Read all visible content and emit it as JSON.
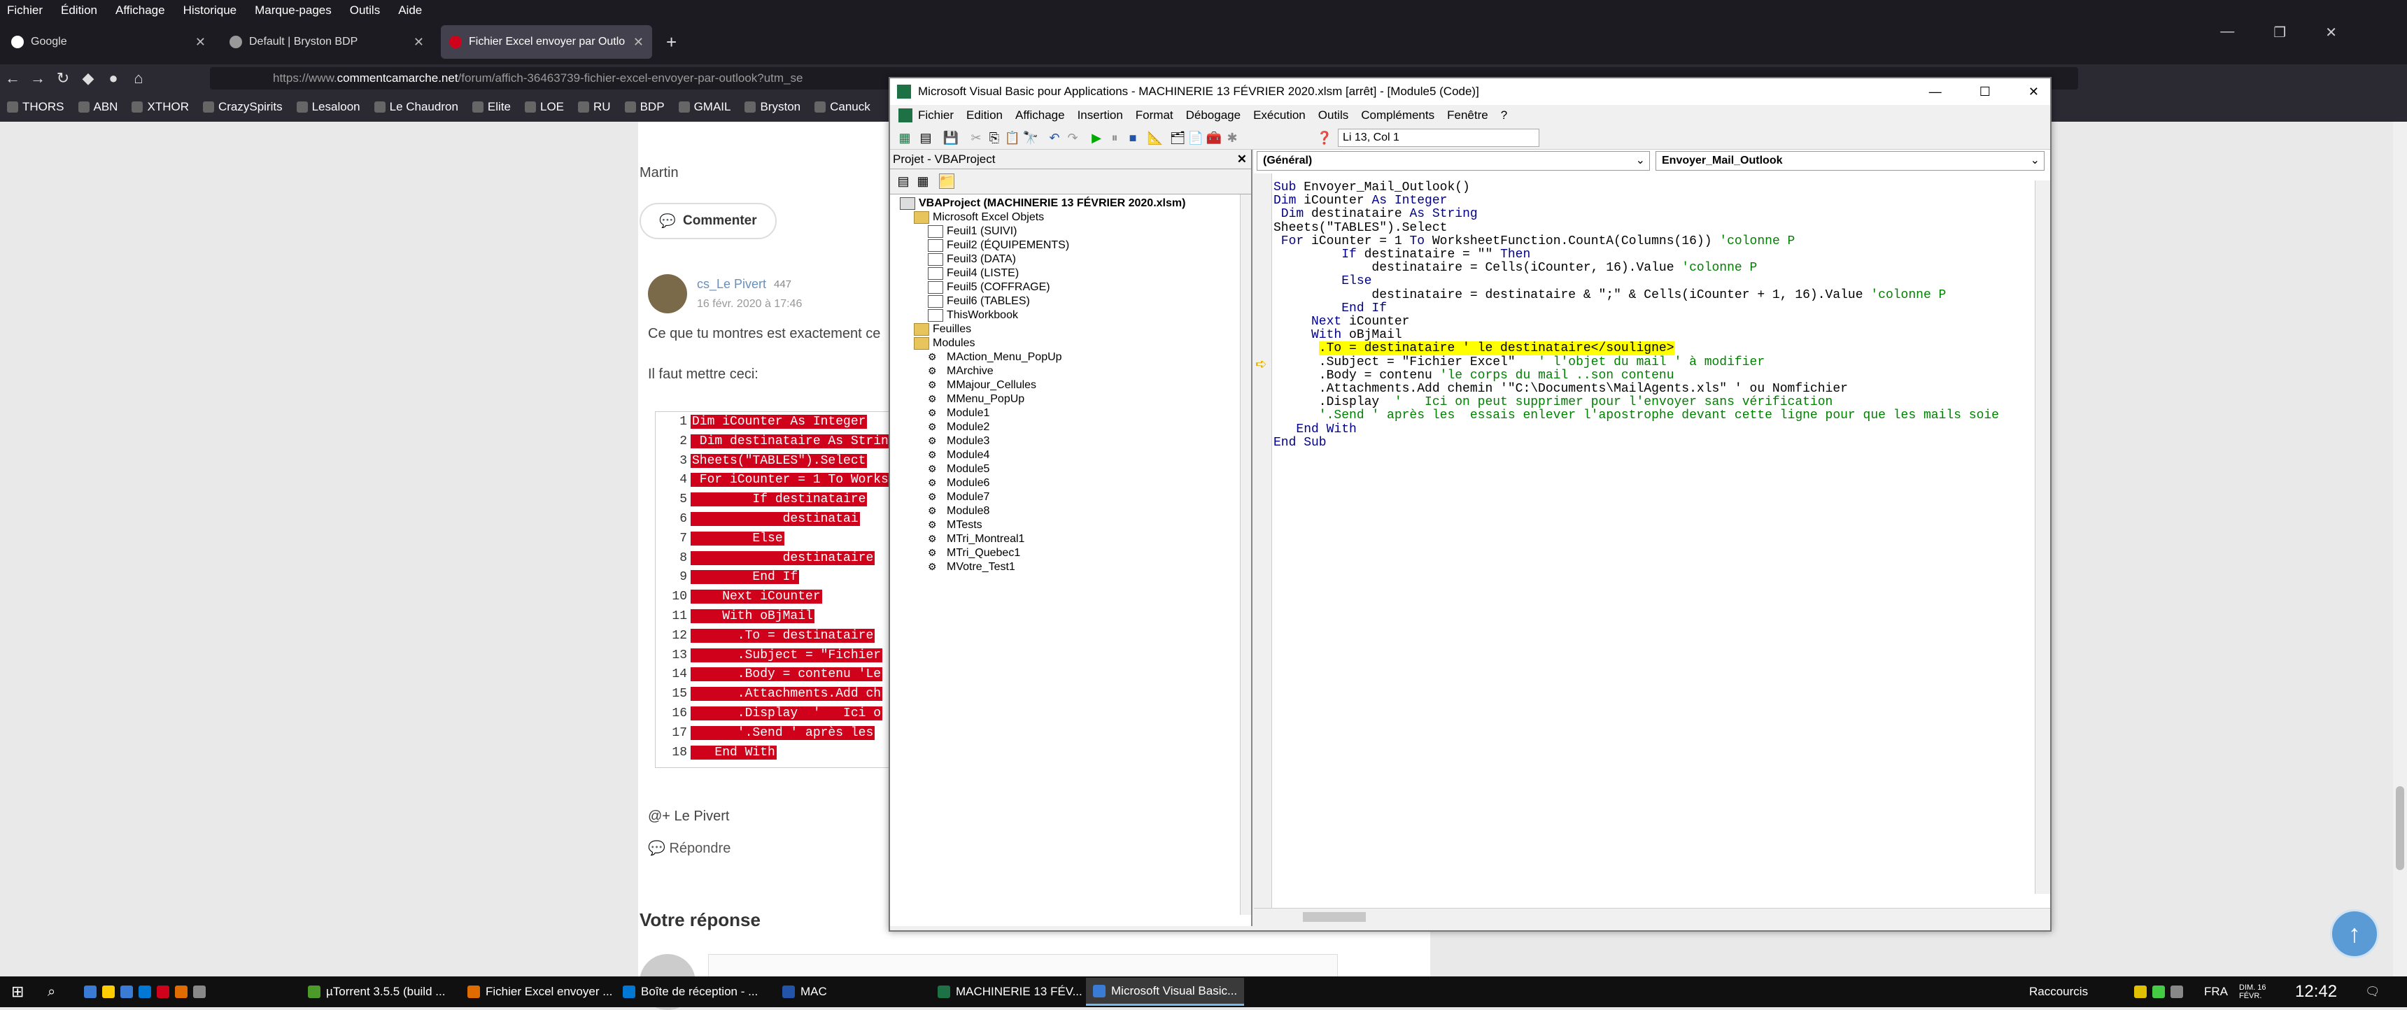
{
  "browser": {
    "menu": [
      "Fichier",
      "Édition",
      "Affichage",
      "Historique",
      "Marque-pages",
      "Outils",
      "Aide"
    ],
    "tabs": [
      {
        "title": "Google"
      },
      {
        "title": "Default | Bryston BDP"
      },
      {
        "title": "Fichier Excel envoyer par Outlo"
      }
    ],
    "new_tab": "+",
    "url_pre": "https://www.",
    "url_domain": "commentcamarche.net",
    "url_post": "/forum/affich-36463739-fichier-excel-envoyer-par-outlook?utm_se",
    "bookmarks": [
      "THORS",
      "ABN",
      "XTHOR",
      "CrazySpirits",
      "Lesaloon",
      "Le Chaudron",
      "Elite",
      "LOE",
      "RU",
      "BDP",
      "GMAIL",
      "Bryston",
      "Canuck"
    ]
  },
  "forum": {
    "author_top": "Martin",
    "comment_btn": "Commenter",
    "user": "cs_Le Pivert",
    "score": "447",
    "date": "16 févr. 2020 à 17:46",
    "line1": "Ce que tu montres est exactement ce",
    "line2": "Il faut mettre ceci:",
    "code": [
      {
        "n": "1",
        "t": "Dim iCounter As Integer"
      },
      {
        "n": "2",
        "t": " Dim destinataire As String"
      },
      {
        "n": "3",
        "t": "Sheets(\"TABLES\").Select"
      },
      {
        "n": "4",
        "t": " For iCounter = 1 To Worksh"
      },
      {
        "n": "5",
        "t": "        If destinataire"
      },
      {
        "n": "6",
        "t": "            destinatai"
      },
      {
        "n": "7",
        "t": "        Else"
      },
      {
        "n": "8",
        "t": "            destinataire"
      },
      {
        "n": "9",
        "t": "        End If"
      },
      {
        "n": "10",
        "t": "    Next iCounter"
      },
      {
        "n": "11",
        "t": "    With oBjMail"
      },
      {
        "n": "12",
        "t": "      .To = destinataire"
      },
      {
        "n": "13",
        "t": "      .Subject = \"Fichier"
      },
      {
        "n": "14",
        "t": "      .Body = contenu 'Le"
      },
      {
        "n": "15",
        "t": "      .Attachments.Add ch"
      },
      {
        "n": "16",
        "t": "      .Display  '   Ici o"
      },
      {
        "n": "17",
        "t": "      '.Send ' après les"
      },
      {
        "n": "18",
        "t": "   End With"
      }
    ],
    "signature": "@+ Le Pivert",
    "reply": "Répondre",
    "your_answer": "Votre réponse"
  },
  "vba": {
    "title": "Microsoft Visual Basic pour Applications - MACHINERIE 13 FÉVRIER 2020.xlsm [arrêt] - [Module5 (Code)]",
    "menu": [
      "Fichier",
      "Edition",
      "Affichage",
      "Insertion",
      "Format",
      "Débogage",
      "Exécution",
      "Outils",
      "Compléments",
      "Fenêtre",
      "?"
    ],
    "position": "Li 13, Col 1",
    "project_title": "Projet - VBAProject",
    "tree": {
      "root": "VBAProject (MACHINERIE 13 FÉVRIER 2020.xlsm)",
      "objects_folder": "Microsoft Excel Objets",
      "sheets": [
        "Feuil1 (SUIVI)",
        "Feuil2 (ÉQUIPEMENTS)",
        "Feuil3 (DATA)",
        "Feuil4 (LISTE)",
        "Feuil5 (COFFRAGE)",
        "Feuil6 (TABLES)",
        "ThisWorkbook"
      ],
      "forms_folder": "Feuilles",
      "modules_folder": "Modules",
      "modules": [
        "MAction_Menu_PopUp",
        "MArchive",
        "MMajour_Cellules",
        "MMenu_PopUp",
        "Module1",
        "Module2",
        "Module3",
        "Module4",
        "Module5",
        "Module6",
        "Module7",
        "Module8",
        "MTests",
        "MTri_Montreal1",
        "MTri_Quebec1",
        "MVotre_Test1"
      ]
    },
    "combo_left": "(Général)",
    "combo_right": "Envoyer_Mail_Outlook",
    "code": [
      [
        {
          "k": "kw",
          "t": "Sub "
        },
        {
          "t": "Envoyer_Mail_Outlook()"
        }
      ],
      [
        {
          "k": "kw",
          "t": "Dim "
        },
        {
          "t": "iCounter "
        },
        {
          "k": "kw",
          "t": "As Integer"
        }
      ],
      [
        {
          "k": "kw",
          "t": " Dim "
        },
        {
          "t": "destinataire "
        },
        {
          "k": "kw",
          "t": "As String"
        }
      ],
      [
        {
          "t": "Sheets(\"TABLES\").Select"
        }
      ],
      [
        {
          "k": "kw",
          "t": " For "
        },
        {
          "t": "iCounter = 1 "
        },
        {
          "k": "kw",
          "t": "To "
        },
        {
          "t": "WorksheetFunction.CountA(Columns(16)) "
        },
        {
          "k": "cm",
          "t": "'colonne P"
        }
      ],
      [
        {
          "k": "kw",
          "t": "         If "
        },
        {
          "t": "destinataire = \"\" "
        },
        {
          "k": "kw",
          "t": "Then"
        }
      ],
      [
        {
          "t": "             destinataire = Cells(iCounter, 16).Value "
        },
        {
          "k": "cm",
          "t": "'colonne P"
        }
      ],
      [
        {
          "k": "kw",
          "t": "         Else"
        }
      ],
      [
        {
          "t": "             destinataire = destinataire & \";\" & Cells(iCounter + 1, 16).Value "
        },
        {
          "k": "cm",
          "t": "'colonne P"
        }
      ],
      [
        {
          "k": "kw",
          "t": "         End If"
        }
      ],
      [
        {
          "k": "kw",
          "t": "     Next "
        },
        {
          "t": "iCounter"
        }
      ],
      [
        {
          "k": "kw",
          "t": "     With "
        },
        {
          "t": "oBjMail"
        }
      ],
      [
        {
          "t": "      "
        },
        {
          "k": "hl",
          "t": ".To = destinataire ' le destinataire</souligne>"
        }
      ],
      [
        {
          "t": "      .Subject = \"Fichier Excel\"   "
        },
        {
          "k": "cm",
          "t": "' l'objet du mail ' à modifier"
        }
      ],
      [
        {
          "t": "      .Body = contenu "
        },
        {
          "k": "cm",
          "t": "'le corps du mail ..son contenu"
        }
      ],
      [
        {
          "t": "      .Attachments.Add chemin '\"C:\\Documents\\MailAgents.xls\" ' ou Nomfichier"
        }
      ],
      [
        {
          "t": "      .Display  "
        },
        {
          "k": "cm",
          "t": "'   Ici on peut supprimer pour l'envoyer sans vérification"
        }
      ],
      [
        {
          "k": "cm",
          "t": "      '.Send ' après les  essais enlever l'apostrophe devant cette ligne pour que les mails soie"
        }
      ],
      [
        {
          "k": "kw",
          "t": "   End With"
        }
      ],
      [
        {
          "k": "kw",
          "t": "End Sub"
        }
      ]
    ]
  },
  "taskbar": {
    "items": [
      "µTorrent 3.5.5  (build ...",
      "Fichier Excel envoyer ...",
      "Boîte de réception - ...",
      "MAC",
      "MACHINERIE 13 FÉV...",
      "Microsoft Visual Basic..."
    ],
    "raccourcis": "Raccourcis",
    "lang": "FRA",
    "date": "DIM. 16 FÉVR.",
    "time": "12:42"
  }
}
